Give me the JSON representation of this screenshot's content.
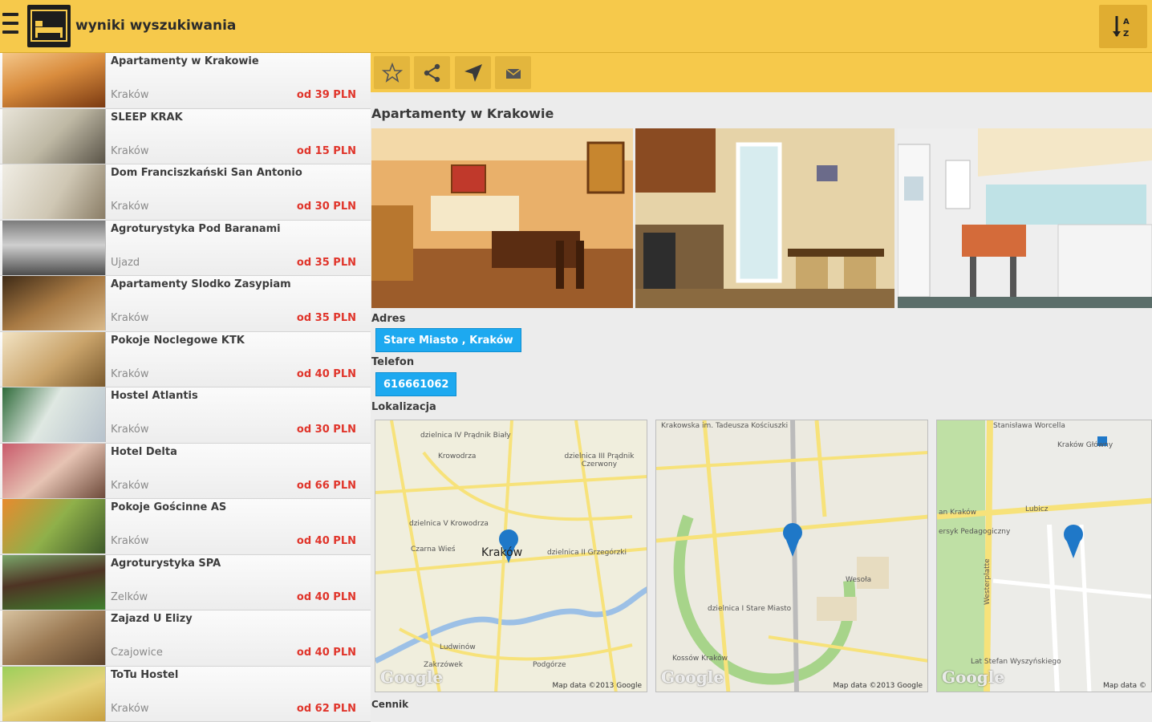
{
  "header": {
    "title": "wyniki wyszukiwania",
    "menu_icon": "hamburger-icon",
    "logo_icon": "bed-icon",
    "sort_icon": "sort-az-icon",
    "colors": {
      "bar": "#f6c94b",
      "price": "#e0342a",
      "chip": "#1da9f0"
    }
  },
  "list": {
    "items": [
      {
        "name": "Apartamenty w Krakowie",
        "city": "Kraków",
        "price": "od 39 PLN"
      },
      {
        "name": "SLEEP KRAK",
        "city": "Kraków",
        "price": "od 15 PLN"
      },
      {
        "name": "Dom Franciszkański San Antonio",
        "city": "Kraków",
        "price": "od 30 PLN"
      },
      {
        "name": "Agroturystyka Pod Baranami",
        "city": "Ujazd",
        "price": "od 35 PLN"
      },
      {
        "name": "Apartamenty Slodko Zasypiam",
        "city": "Kraków",
        "price": "od 35 PLN"
      },
      {
        "name": "Pokoje Noclegowe KTK",
        "city": "Kraków",
        "price": "od 40 PLN"
      },
      {
        "name": "Hostel Atlantis",
        "city": "Kraków",
        "price": "od 30 PLN"
      },
      {
        "name": "Hotel Delta",
        "city": "Kraków",
        "price": "od 66 PLN"
      },
      {
        "name": "Pokoje Gościnne AS",
        "city": "Kraków",
        "price": "od 40 PLN"
      },
      {
        "name": "Agroturystyka SPA",
        "city": "Zelków",
        "price": "od 40 PLN"
      },
      {
        "name": "Zajazd U Elizy",
        "city": "Czajowice",
        "price": "od 40 PLN"
      },
      {
        "name": "ToTu Hostel",
        "city": "Kraków",
        "price": "od 62 PLN"
      }
    ]
  },
  "detail": {
    "toolbar": [
      "star-icon",
      "share-icon",
      "navigate-icon",
      "mail-icon"
    ],
    "title": "Apartamenty w Krakowie",
    "address_label": "Adres",
    "address_value": "Stare Miasto , Kraków",
    "phone_label": "Telefon",
    "phone_value": "616661062",
    "location_label": "Lokalizacja",
    "maps": [
      {
        "google": "Google",
        "mapdata": "Map data ©2013 Google",
        "labels": [
          "dzielnica IV Prądnik Biały",
          "Krowodrza",
          "dzielnica III Prądnik Czerwony",
          "dzielnica V Krowodrza",
          "Czarna Wieś",
          "Kraków",
          "dzielnica II Grzegórzki",
          "Ludwinów",
          "Zakrzówek",
          "Podgórze"
        ]
      },
      {
        "google": "Google",
        "mapdata": "Map data ©2013 Google",
        "labels": [
          "Krakowska im. Tadeusza Kościuszki",
          "Wesoła",
          "dzielnica I Stare Miasto",
          "Kossów Kraków"
        ]
      },
      {
        "google": "Google",
        "mapdata": "Map data ©",
        "labels": [
          "Stanisława Worcella",
          "Kraków Główny",
          "an Kraków",
          "Lubicz",
          "ersyk Pedagogiczny",
          "Westerplatte",
          "Lat Stefan Wyszyńskiego"
        ]
      }
    ],
    "price_list_label": "Cennik"
  }
}
